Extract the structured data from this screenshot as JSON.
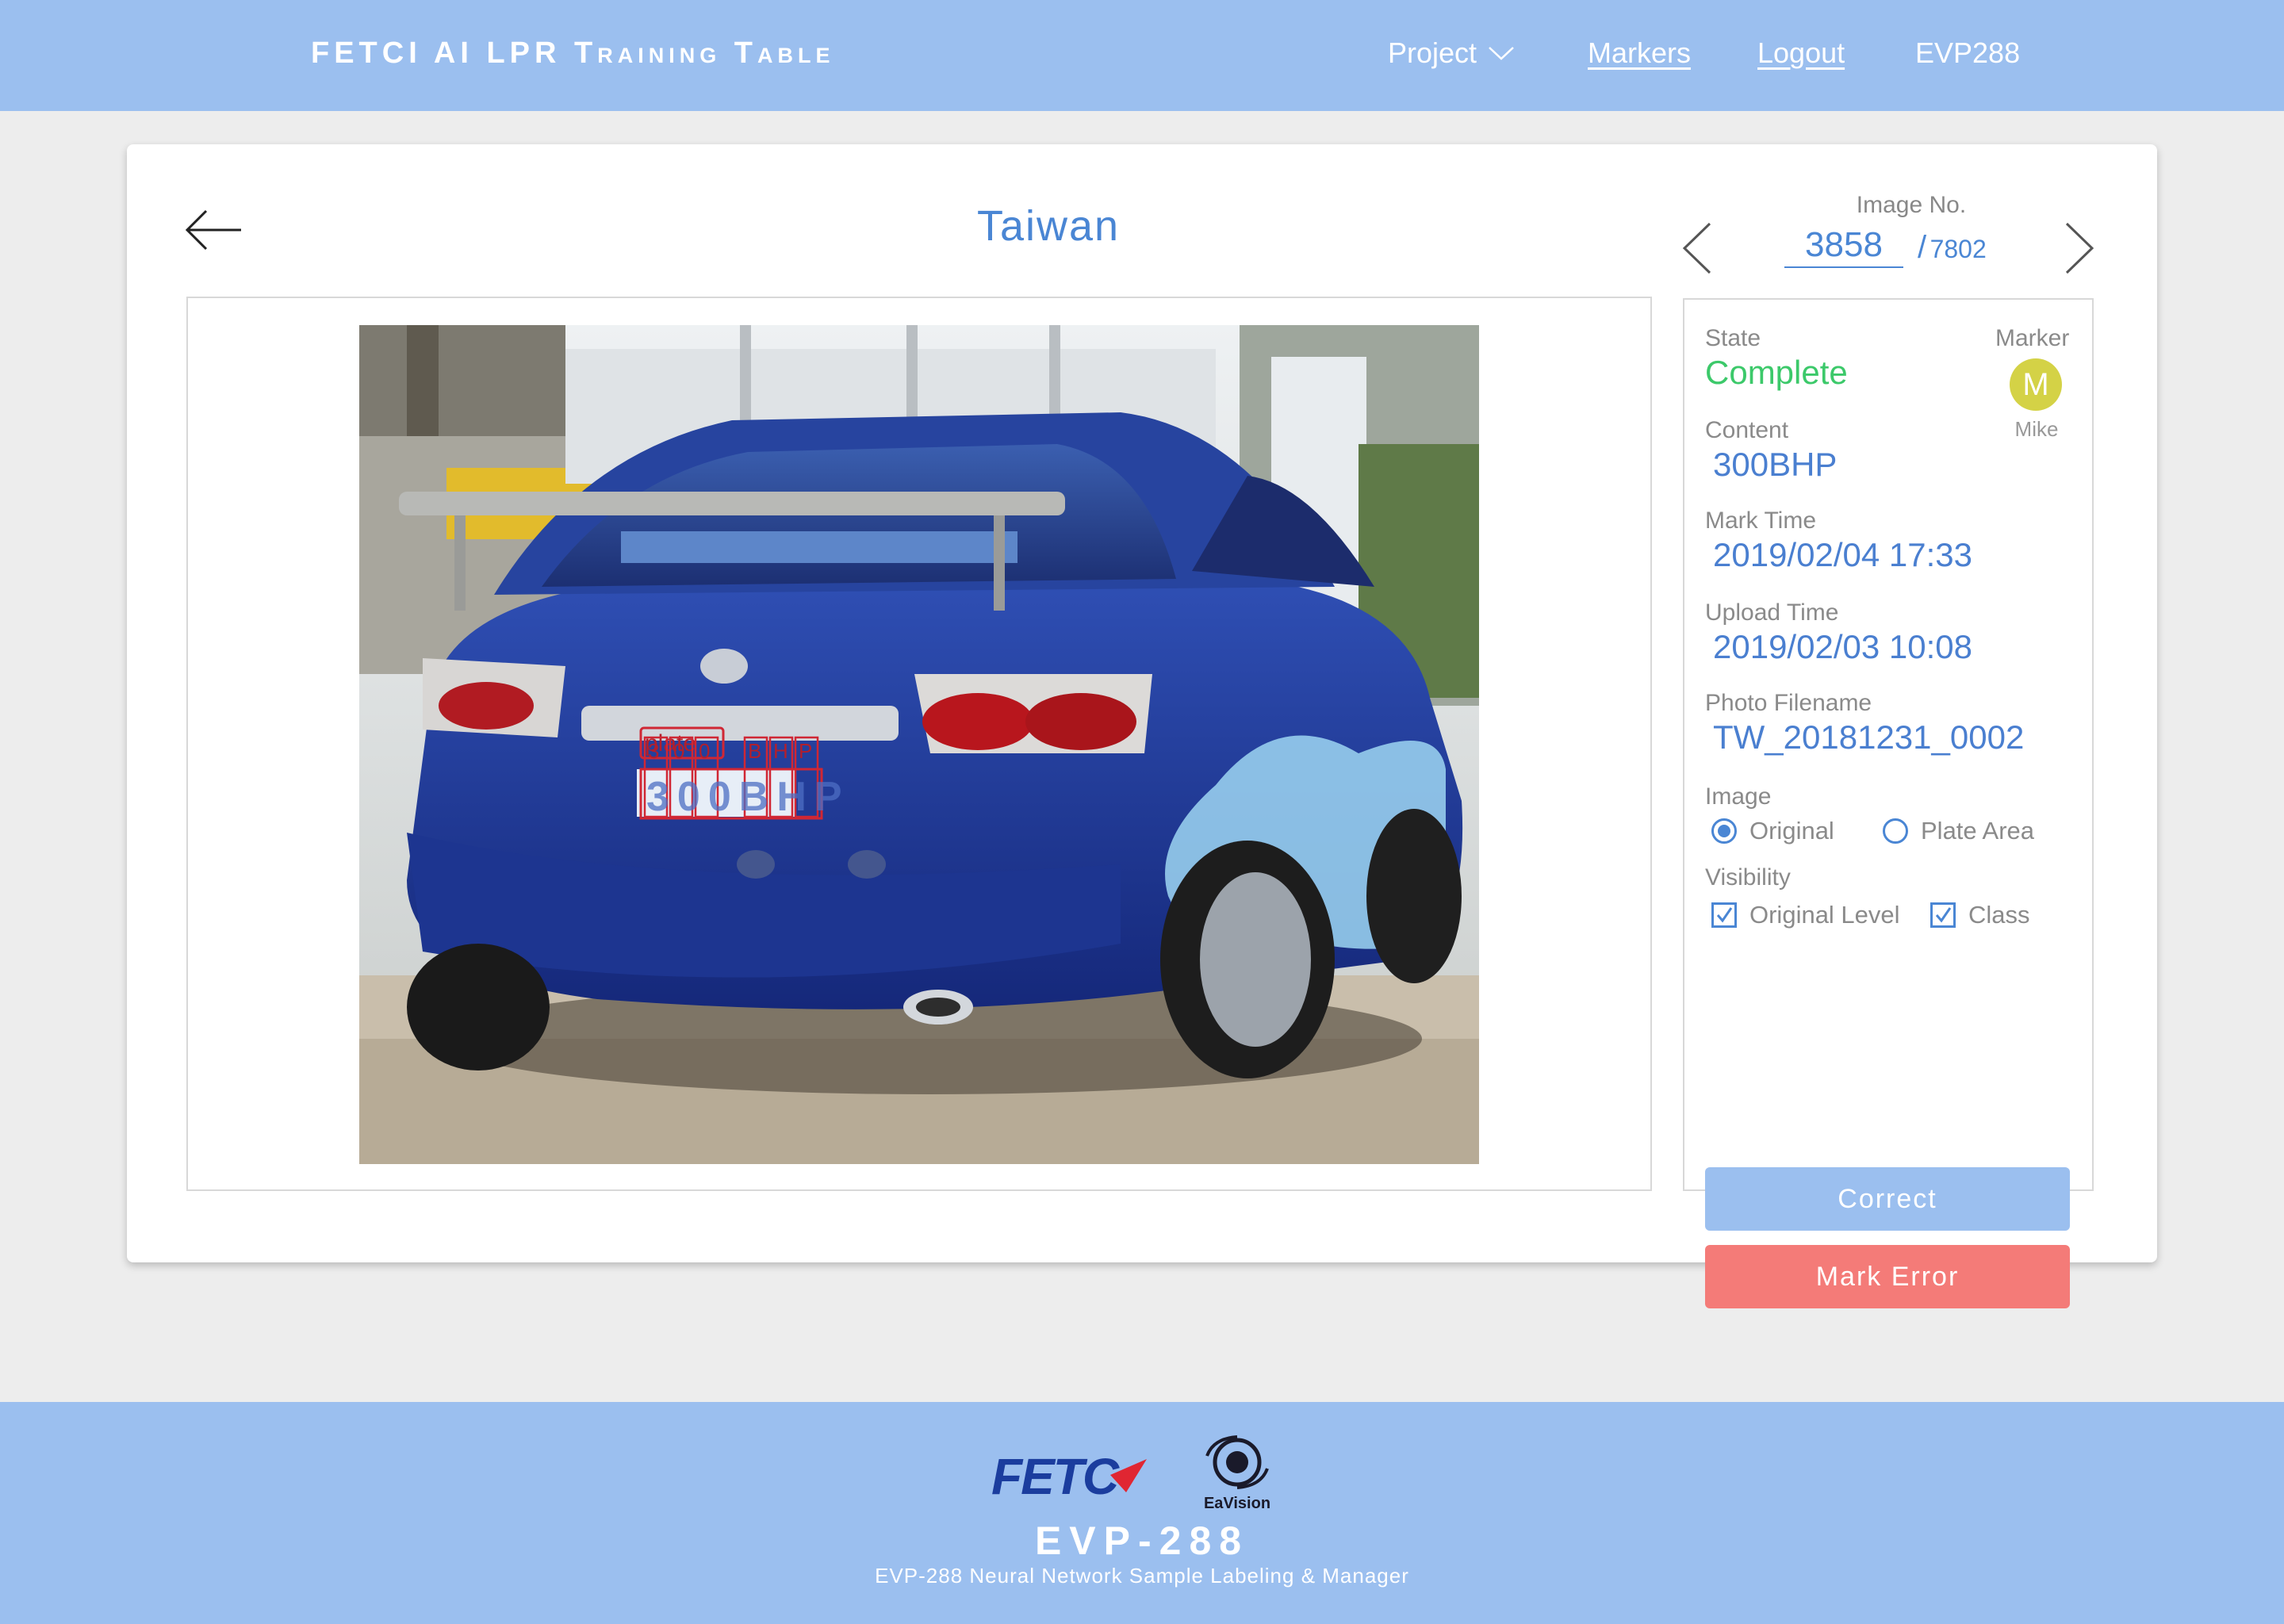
{
  "header": {
    "brand": "FETCI AI LPR Training Table",
    "nav": {
      "project": "Project",
      "markers": "Markers",
      "logout": "Logout",
      "user": "EVP288"
    }
  },
  "viewer": {
    "title": "Taiwan",
    "image_no_label": "Image No.",
    "image_no": "3858",
    "image_total_slash": "/",
    "image_total": "7802",
    "photo": {
      "plate_box_label": "plate",
      "char_labels": [
        "3",
        "0",
        "0",
        "B",
        "H",
        "P"
      ],
      "plate_text": "300BHP"
    }
  },
  "info": {
    "state_label": "State",
    "state_value": "Complete",
    "marker_label": "Marker",
    "marker_initial": "M",
    "marker_name": "Mike",
    "content_label": "Content",
    "content_value": "300BHP",
    "mark_time_label": "Mark Time",
    "mark_time_value": "2019/02/04 17:33",
    "upload_time_label": "Upload Time",
    "upload_time_value": "2019/02/03 10:08",
    "filename_label": "Photo Filename",
    "filename_value": "TW_20181231_0002",
    "image_label": "Image",
    "image_options": {
      "original": "Original",
      "plate_area": "Plate Area",
      "selected": "Original"
    },
    "visibility_label": "Visibility",
    "visibility_options": {
      "original_level": "Original Level",
      "class": "Class",
      "original_level_checked": true,
      "class_checked": true
    },
    "correct_button": "Correct",
    "mark_error_button": "Mark Error"
  },
  "footer": {
    "logo_fetc": "FETC",
    "logo_eavision": "EaVision",
    "product": "EVP-288",
    "subtitle": "EVP-288 Neural Network Sample Labeling & Manager"
  },
  "colors": {
    "header_bg": "#9bbfef",
    "accent_blue": "#4a86d4",
    "state_green": "#3cc96a",
    "error_red": "#f47b78",
    "avatar_yellow": "#d4d246"
  },
  "icons": [
    "chevron-down-icon",
    "arrow-left-icon",
    "chevron-left-icon",
    "chevron-right-icon",
    "radio-icon",
    "checkbox-icon"
  ]
}
